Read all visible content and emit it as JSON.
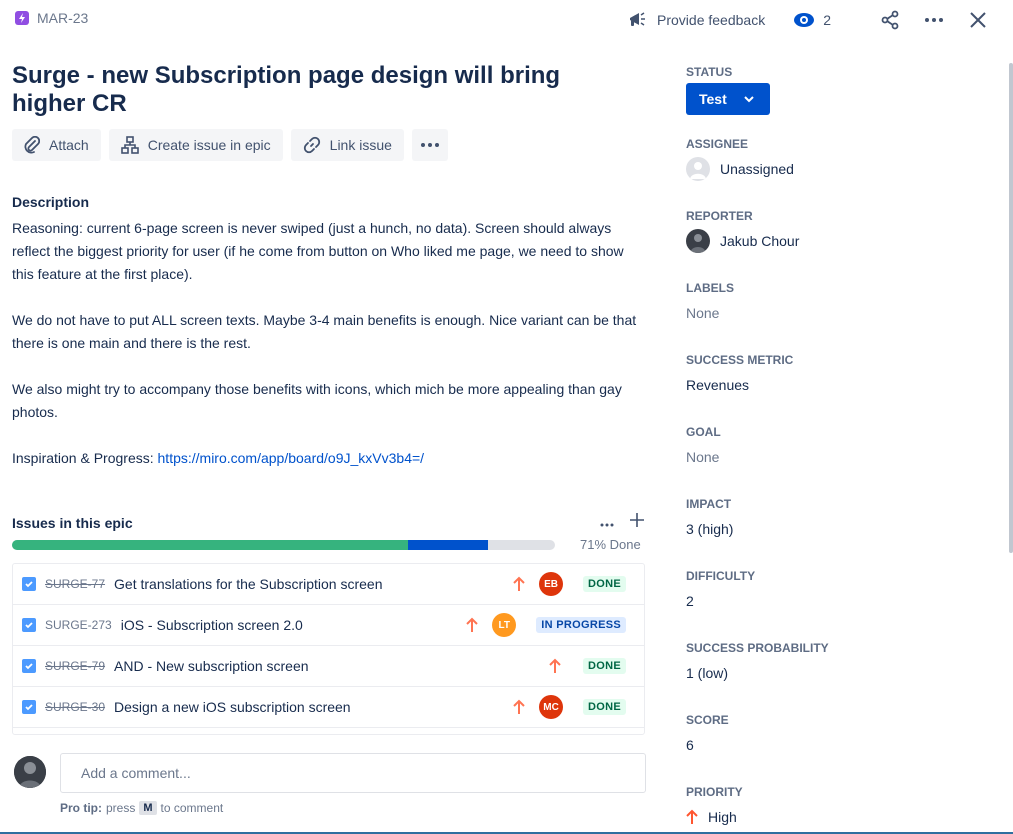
{
  "header": {
    "epic_key": "MAR-23",
    "feedback_label": "Provide feedback",
    "watch_count": "2"
  },
  "issue": {
    "title": "Surge - new Subscription page design will bring higher CR"
  },
  "actions": {
    "attach": "Attach",
    "create_in_epic": "Create issue in epic",
    "link_issue": "Link issue"
  },
  "description": {
    "label": "Description",
    "p1": "Reasoning: current 6-page screen is never swiped (just a hunch, no data). Screen should always reflect the biggest priority for user (if he come from button on Who liked me page, we need to show this feature at the first place).",
    "p2": "We do not have to put ALL screen texts. Maybe 3-4 main benefits is enough. Nice variant can be that there is one main and there is the rest.",
    "p3": "We also might try to accompany those benefits with icons, which mich be more appealing than gay photos.",
    "p4_prefix": "Inspiration & Progress: ",
    "p4_link": "https://miro.com/app/board/o9J_kxVv3b4=/"
  },
  "epic_issues": {
    "title": "Issues in this epic",
    "done_pct": "71% Done",
    "progress": {
      "done": 0.73,
      "in_progress": 0.147
    },
    "rows": [
      {
        "key": "SURGE-77",
        "summary": "Get translations for the Subscription screen",
        "assignee": "EB",
        "avatar_color": "#de350b",
        "status": "DONE",
        "status_type": "done",
        "strike": true
      },
      {
        "key": "SURGE-273",
        "summary": "iOS - Subscription screen 2.0",
        "assignee": "LT",
        "avatar_color": "#ff991f",
        "status": "IN PROGRESS",
        "status_type": "prog",
        "strike": false
      },
      {
        "key": "SURGE-79",
        "summary": "AND - New subscription screen",
        "assignee": "",
        "avatar_color": "",
        "status": "DONE",
        "status_type": "done",
        "strike": true
      },
      {
        "key": "SURGE-30",
        "summary": "Design a new iOS subscription screen",
        "assignee": "MC",
        "avatar_color": "#de350b",
        "status": "DONE",
        "status_type": "done",
        "strike": true
      }
    ]
  },
  "comment": {
    "placeholder": "Add a comment...",
    "protip_label": "Pro tip:",
    "protip_press": "press",
    "protip_key": "M",
    "protip_suffix": "to comment"
  },
  "sidebar": {
    "status_label": "STATUS",
    "status_value": "Test",
    "assignee_label": "ASSIGNEE",
    "assignee_value": "Unassigned",
    "reporter_label": "REPORTER",
    "reporter_value": "Jakub Chour",
    "labels_label": "LABELS",
    "labels_value": "None",
    "success_metric_label": "SUCCESS METRIC",
    "success_metric_value": "Revenues",
    "goal_label": "GOAL",
    "goal_value": "None",
    "impact_label": "IMPACT",
    "impact_value": "3 (high)",
    "difficulty_label": "DIFFICULTY",
    "difficulty_value": "2",
    "probability_label": "SUCCESS PROBABILITY",
    "probability_value": "1 (low)",
    "score_label": "SCORE",
    "score_value": "6",
    "priority_label": "PRIORITY",
    "priority_value": "High"
  },
  "colors": {
    "primary": "#0052cc",
    "done": "#36b37e",
    "priority_high": "#ff7452"
  }
}
